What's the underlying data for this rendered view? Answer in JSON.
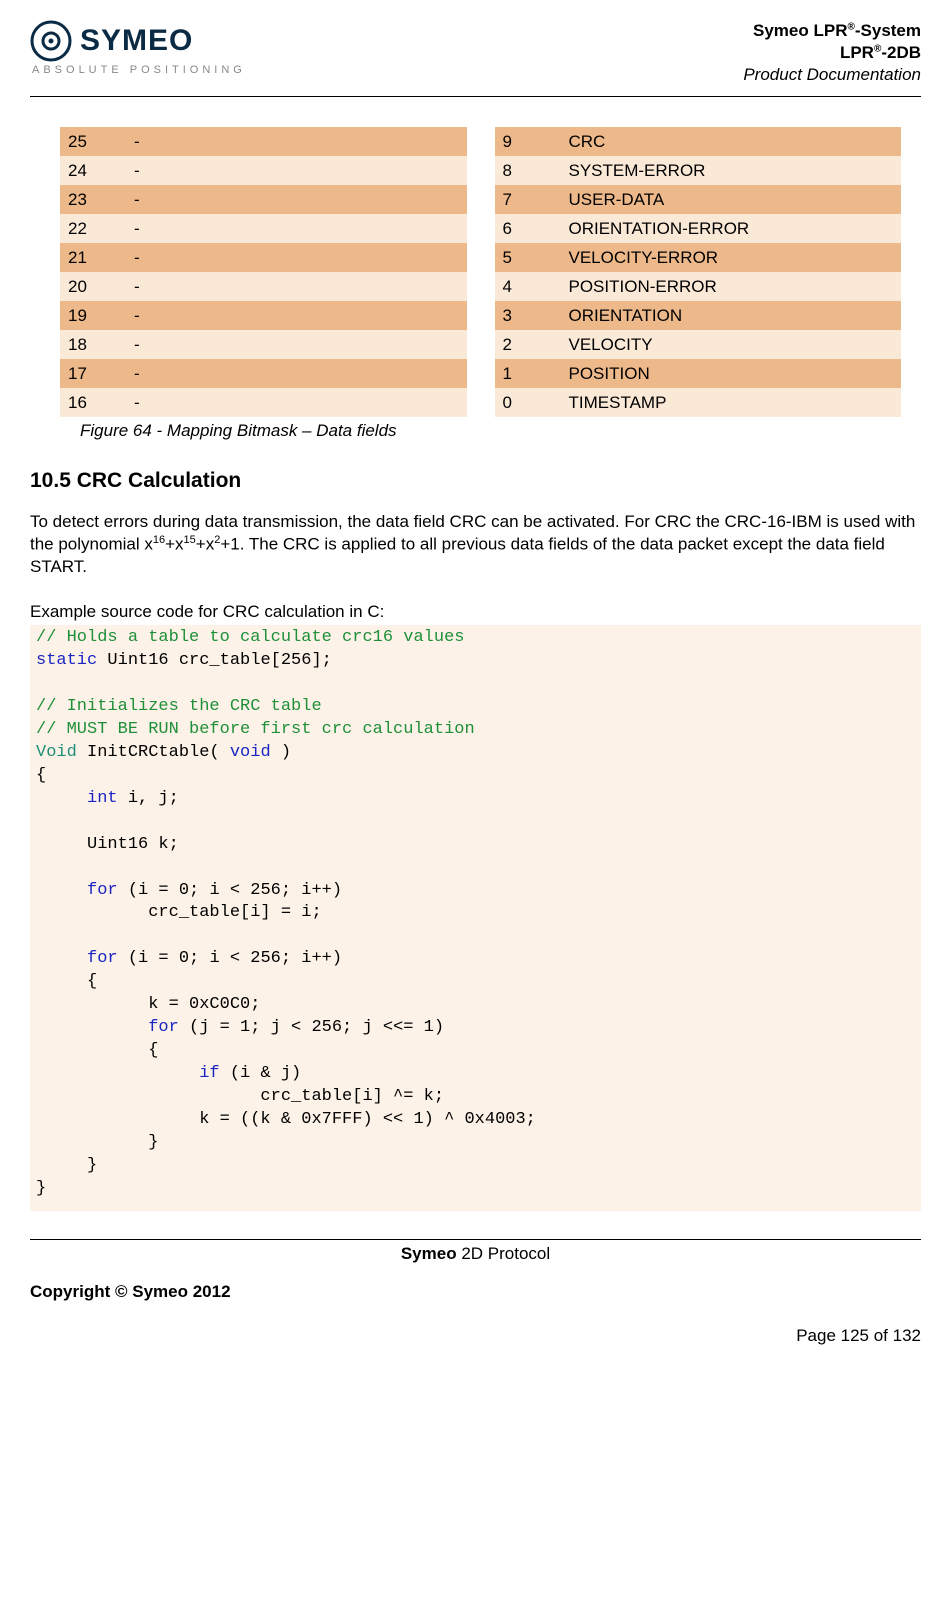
{
  "header": {
    "logo_main": "SYMEO",
    "logo_sub": "ABSOLUTE POSITIONING",
    "line1_pre": "Symeo LPR",
    "line1_sup": "®",
    "line1_post": "-System",
    "line2_pre": "LPR",
    "line2_sup": "®",
    "line2_post": "-2DB",
    "line3": "Product Documentation"
  },
  "left_table": [
    {
      "n": "25",
      "v": "-"
    },
    {
      "n": "24",
      "v": "-"
    },
    {
      "n": "23",
      "v": "-"
    },
    {
      "n": "22",
      "v": "-"
    },
    {
      "n": "21",
      "v": "-"
    },
    {
      "n": "20",
      "v": "-"
    },
    {
      "n": "19",
      "v": "-"
    },
    {
      "n": "18",
      "v": "-"
    },
    {
      "n": "17",
      "v": "-"
    },
    {
      "n": "16",
      "v": "-"
    }
  ],
  "right_table": [
    {
      "n": "9",
      "v": "CRC"
    },
    {
      "n": "8",
      "v": "SYSTEM-ERROR"
    },
    {
      "n": "7",
      "v": "USER-DATA"
    },
    {
      "n": "6",
      "v": "ORIENTATION-ERROR"
    },
    {
      "n": "5",
      "v": "VELOCITY-ERROR"
    },
    {
      "n": "4",
      "v": "POSITION-ERROR"
    },
    {
      "n": "3",
      "v": "ORIENTATION"
    },
    {
      "n": "2",
      "v": "VELOCITY"
    },
    {
      "n": "1",
      "v": "POSITION"
    },
    {
      "n": "0",
      "v": "TIMESTAMP"
    }
  ],
  "caption": "Figure 64 - Mapping Bitmask – Data fields",
  "section_title": "10.5  CRC Calculation",
  "para": {
    "p1": "To detect errors during data transmission, the data field CRC can be activated. For CRC the CRC-16-IBM is used with the polynomial x",
    "s1": "16",
    "p2": "+x",
    "s2": "15",
    "p3": "+x",
    "s3": "2",
    "p4": "+1. The CRC is applied to all previous data fields of the data packet except the data field START."
  },
  "example_label": "Example source code for CRC calculation in C:",
  "code": {
    "c1": "// Holds a table to calculate crc16 values",
    "k1": "static",
    "t1": " Uint16 crc_table[256];",
    "c2": "// Initializes the CRC table",
    "c3": "// MUST BE RUN before first crc calculation",
    "ty1": "Void",
    "t2": " InitCRCtable( ",
    "k2": "void",
    "t3": " )",
    "t4": "{",
    "sp1": "     ",
    "k3": "int",
    "t5": " i, j;",
    "t6": "     Uint16 k;",
    "sp2": "     ",
    "k4": "for",
    "t7": " (i = 0; i < 256; i++)",
    "t8": "           crc_table[i] = i;",
    "sp3": "     ",
    "k5": "for",
    "t9": " (i = 0; i < 256; i++)",
    "t10": "     {",
    "t11": "           k = 0xC0C0;",
    "sp4": "           ",
    "k6": "for",
    "t12": " (j = 1; j < 256; j <<= 1)",
    "t13": "           {",
    "sp5": "                ",
    "k7": "if",
    "t14": " (i & j)",
    "t15": "                      crc_table[i] ^= k;",
    "t16": "                k = ((k & 0x7FFF) << 1) ^ 0x4003;",
    "t17": "           }",
    "t18": "     }",
    "t19": "}"
  },
  "footer": {
    "center_bold": "Symeo",
    "center_rest": " 2D Protocol",
    "left": "Copyright © Symeo 2012",
    "right": "Page 125 of 132"
  }
}
